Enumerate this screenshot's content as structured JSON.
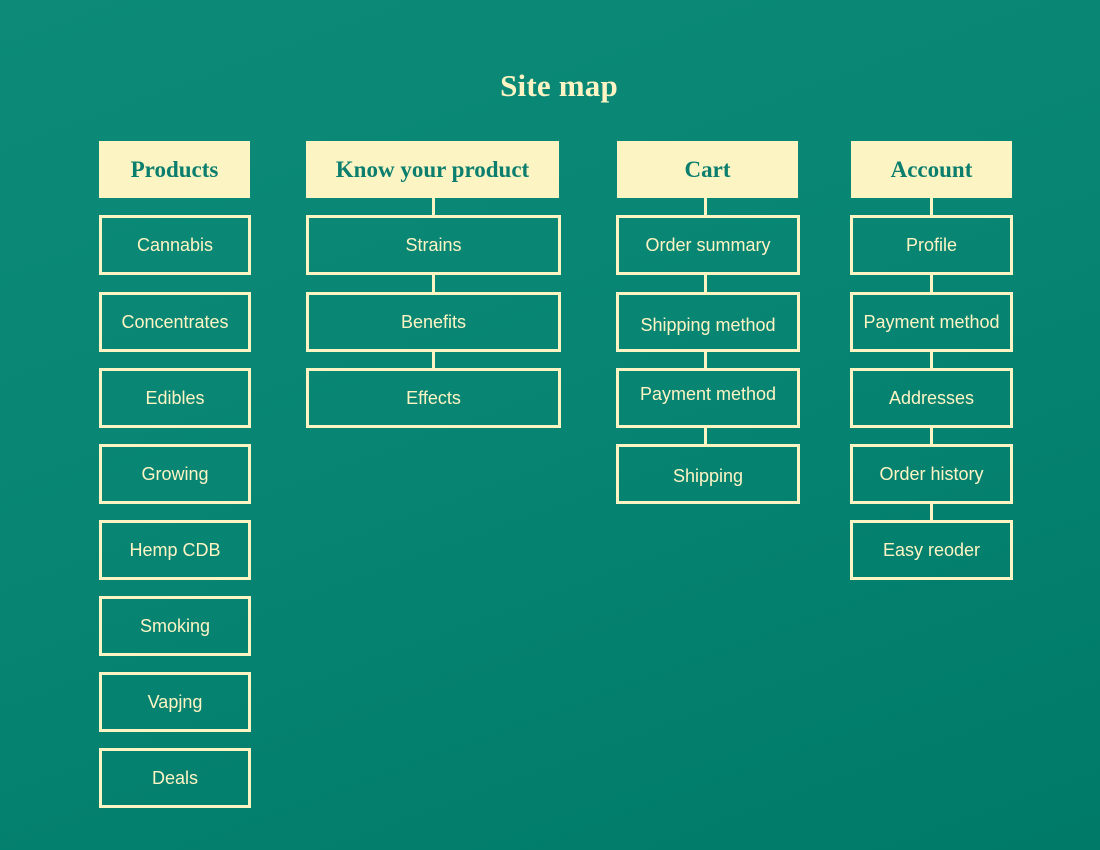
{
  "title": "Site map",
  "columns": [
    {
      "header": "Products",
      "items": [
        "Cannabis",
        "Concentrates",
        "Edibles",
        "Growing",
        "Hemp CDB",
        "Smoking",
        "Vapjng",
        "Deals"
      ]
    },
    {
      "header": "Know your product",
      "items": [
        "Strains",
        "Benefits",
        "Effects"
      ]
    },
    {
      "header": "Cart",
      "items": [
        "Order summary",
        "Shipping method",
        "Payment method",
        "Shipping"
      ]
    },
    {
      "header": "Account",
      "items": [
        "Profile",
        "Payment method",
        "Addresses",
        "Order history",
        "Easy reoder"
      ]
    }
  ],
  "colors": {
    "background": "#088573",
    "box_fill": "#fdf4c4",
    "text_dark": "#0b7e6d",
    "text_light": "#fdf4c4"
  }
}
